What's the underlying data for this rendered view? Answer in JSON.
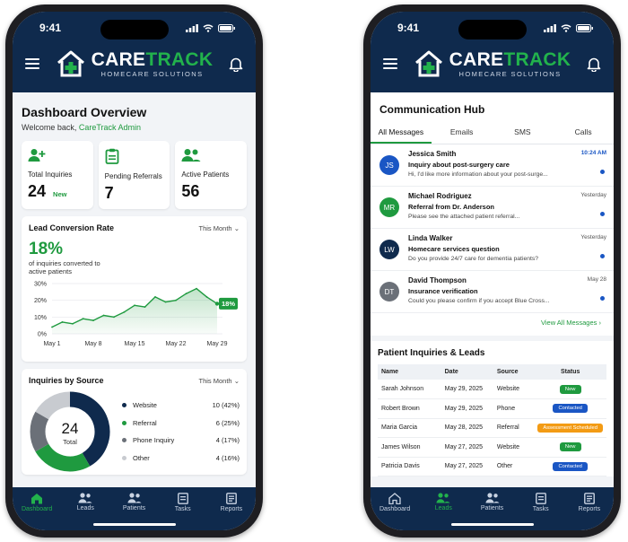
{
  "status_time": "9:41",
  "brand": {
    "name_part1": "CARE",
    "name_part2": "TRACK",
    "tagline": "HOMECARE SOLUTIONS",
    "accent": "#22b24c",
    "navy": "#0f2a4d"
  },
  "dashboard": {
    "title": "Dashboard Overview",
    "welcome_prefix": "Welcome back, ",
    "welcome_name": "CareTrack Admin",
    "stats": [
      {
        "label": "Total Inquiries",
        "value": "24",
        "badge": "New",
        "icon": "add-user-icon"
      },
      {
        "label": "Pending Referrals",
        "value": "7",
        "icon": "clipboard-icon"
      },
      {
        "label": "Active Patients",
        "value": "56",
        "icon": "users-icon"
      }
    ],
    "conversion": {
      "title": "Lead Conversion Rate",
      "period": "This Month",
      "value": "18%",
      "caption": "of inquiries converted to active patients"
    },
    "sources": {
      "title": "Inquiries by Source",
      "period": "This Month",
      "total_value": "24",
      "total_label": "Total"
    }
  },
  "tabbar": [
    "Dashboard",
    "Leads",
    "Patients",
    "Tasks",
    "Reports"
  ],
  "chart_data": [
    {
      "type": "area",
      "x": [
        "May 1",
        "May 3",
        "May 5",
        "May 7",
        "May 8",
        "May 9",
        "May 11",
        "May 13",
        "May 15",
        "May 16",
        "May 18",
        "May 20",
        "May 22",
        "May 24",
        "May 25",
        "May 27",
        "May 29"
      ],
      "series": [
        {
          "values": [
            4,
            7,
            6,
            9,
            8,
            11,
            10,
            13,
            17,
            16,
            22,
            19,
            20,
            24,
            27,
            22,
            18
          ]
        }
      ],
      "x_tick_labels": [
        "May 1",
        "May 8",
        "May 15",
        "May 22",
        "May 29"
      ],
      "y_tick_labels": [
        "0%",
        "10%",
        "20%",
        "30%"
      ],
      "ylim": [
        0,
        30
      ],
      "end_label": "18%",
      "grid": true,
      "color": "#1f9a3f"
    },
    {
      "type": "pie",
      "categories": [
        "Website",
        "Referral",
        "Phone Inquiry",
        "Other"
      ],
      "values": [
        10,
        6,
        4,
        4
      ],
      "labels": [
        "10 (42%)",
        "6 (25%)",
        "4 (17%)",
        "4 (16%)"
      ],
      "colors": [
        "#0f2a4d",
        "#1f9a3f",
        "#6b7078",
        "#c8cbd0"
      ],
      "center_value": "24",
      "center_label": "Total"
    }
  ],
  "hub": {
    "title": "Communication Hub",
    "tabs": [
      "All Messages",
      "Emails",
      "SMS",
      "Calls"
    ],
    "messages": [
      {
        "initials": "JS",
        "color": "#1a56c4",
        "sender": "Jessica Smith",
        "time": "10:24 AM",
        "subject": "Inquiry about post-surgery care",
        "preview": "Hi, I'd like more information about your post-surge..."
      },
      {
        "initials": "MR",
        "color": "#1f9a3f",
        "sender": "Michael Rodriguez",
        "time": "Yesterday",
        "subject": "Referral from Dr. Anderson",
        "preview": "Please see the attached patient referral..."
      },
      {
        "initials": "LW",
        "color": "#0f2a4d",
        "sender": "Linda Walker",
        "time": "Yesterday",
        "subject": "Homecare services question",
        "preview": "Do you provide 24/7 care for dementia patients?"
      },
      {
        "initials": "DT",
        "color": "#6b7078",
        "sender": "David Thompson",
        "time": "May 28",
        "subject": "Insurance verification",
        "preview": "Could you please confirm if you accept Blue Cross..."
      }
    ],
    "view_all": "View All Messages"
  },
  "leads": {
    "title": "Patient Inquiries & Leads",
    "columns": [
      "Name",
      "Date",
      "Source",
      "Status"
    ],
    "rows": [
      {
        "name": "Sarah Johnson",
        "date": "May 29, 2025",
        "source": "Website",
        "status": "New"
      },
      {
        "name": "Robert Brown",
        "date": "May 29, 2025",
        "source": "Phone",
        "status": "Contacted"
      },
      {
        "name": "Maria Garcia",
        "date": "May 28, 2025",
        "source": "Referral",
        "status": "Assessment Scheduled"
      },
      {
        "name": "James Wilson",
        "date": "May 27, 2025",
        "source": "Website",
        "status": "New"
      },
      {
        "name": "Patricia Davis",
        "date": "May 27, 2025",
        "source": "Other",
        "status": "Contacted"
      }
    ]
  }
}
